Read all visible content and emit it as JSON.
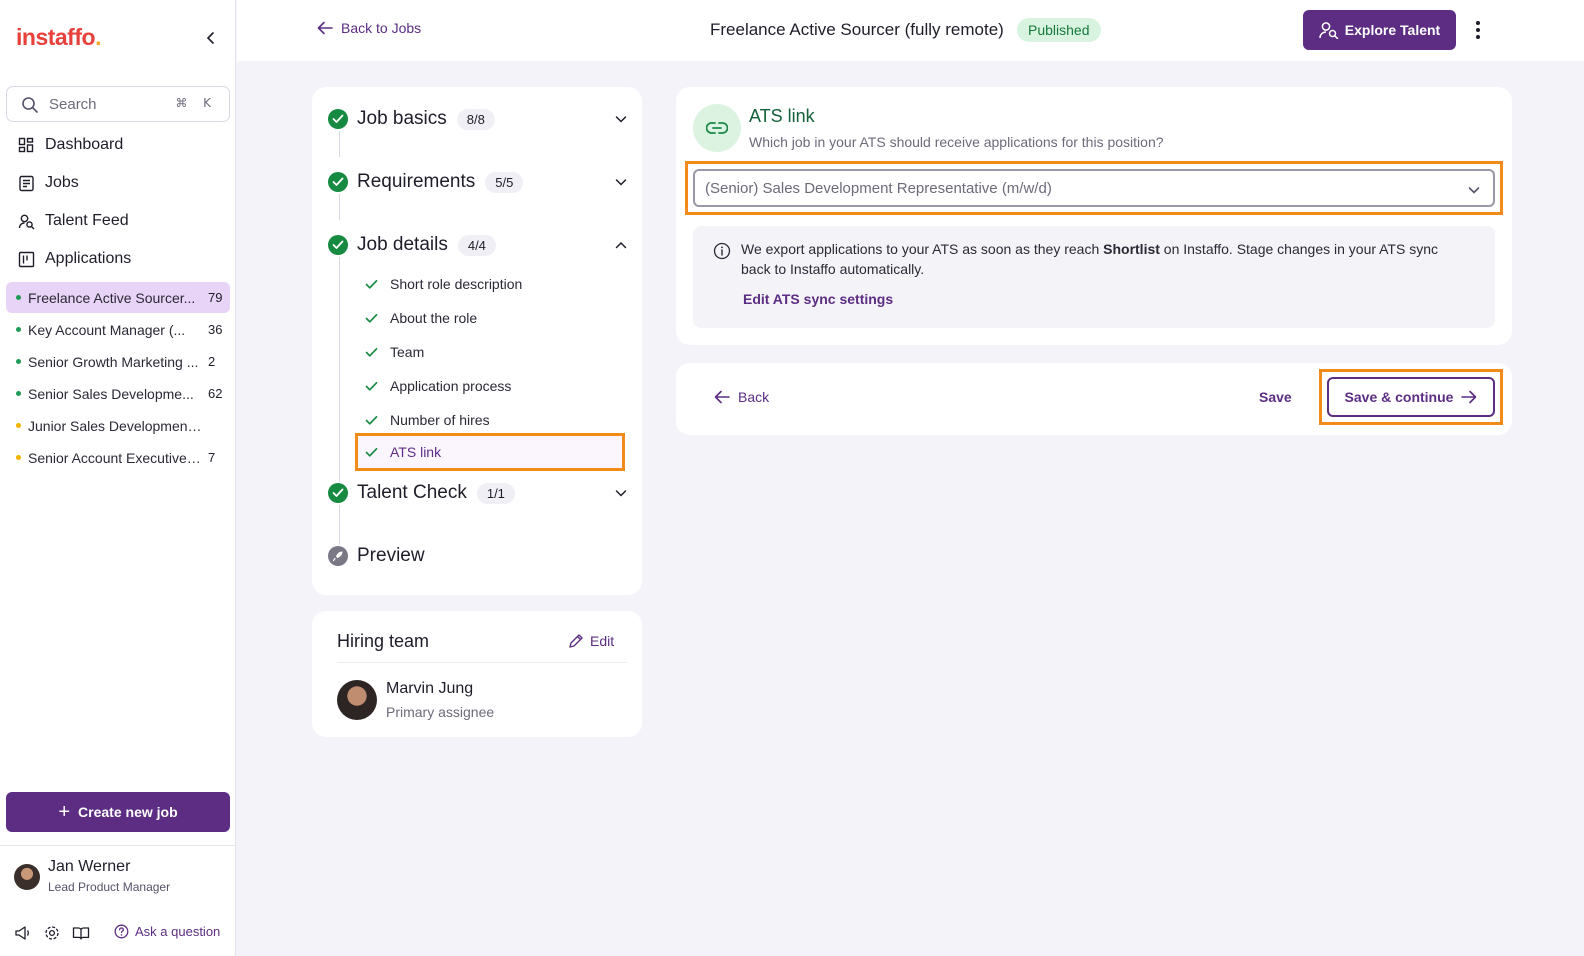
{
  "brand": {
    "logo_text": "instaffo",
    "logo_dot": "."
  },
  "sidebar": {
    "search": {
      "label": "Search",
      "shortcut": "⌘ K"
    },
    "nav": [
      {
        "label": "Dashboard",
        "icon": "dashboard-icon"
      },
      {
        "label": "Jobs",
        "icon": "jobs-icon"
      },
      {
        "label": "Talent Feed",
        "icon": "talent-feed-icon"
      },
      {
        "label": "Applications",
        "icon": "applications-icon"
      }
    ],
    "jobs": [
      {
        "title": "Freelance Active Sourcer...",
        "count": "79",
        "status_color": "#1f9d55",
        "active": true
      },
      {
        "title": "Key Account Manager (...",
        "count": "36",
        "status_color": "#1f9d55"
      },
      {
        "title": "Senior Growth Marketing ...",
        "count": "2",
        "status_color": "#1f9d55"
      },
      {
        "title": "Senior Sales Developme...",
        "count": "62",
        "status_color": "#1f9d55"
      },
      {
        "title": "Junior Sales Development R...",
        "count": "",
        "status_color": "#f5b400"
      },
      {
        "title": "Senior Account Executive ...",
        "count": "7",
        "status_color": "#f5b400"
      }
    ],
    "create_label": "Create new job",
    "user": {
      "name": "Jan Werner",
      "role": "Lead Product Manager"
    },
    "ask_label": "Ask a question"
  },
  "topbar": {
    "back_label": "Back to Jobs",
    "job_title": "Freelance Active Sourcer (fully remote)",
    "status": "Published",
    "explore_label": "Explore Talent"
  },
  "steps": {
    "items": [
      {
        "label": "Job basics",
        "count": "8/8"
      },
      {
        "label": "Requirements",
        "count": "5/5"
      },
      {
        "label": "Job details",
        "count": "4/4"
      },
      {
        "label": "Talent Check",
        "count": "1/1"
      },
      {
        "label": "Preview"
      }
    ],
    "job_details_sub": [
      "Short role description",
      "About the role",
      "Team",
      "Application process",
      "Number of hires",
      "ATS link"
    ]
  },
  "hiring_team": {
    "title": "Hiring team",
    "edit_label": "Edit",
    "assignee_name": "Marvin Jung",
    "assignee_role": "Primary assignee"
  },
  "ats": {
    "title": "ATS link",
    "subtitle": "Which job in your ATS should receive applications for this position?",
    "selected": "(Senior) Sales Development Representative (m/w/d)",
    "info_part1": "We export applications to your ATS as soon as they reach ",
    "info_bold": "Shortlist",
    "info_part2": " on Instaffo. Stage changes in your ATS sync back to Instaffo automatically.",
    "info_link": "Edit ATS sync settings"
  },
  "actions": {
    "back_label": "Back",
    "save_label": "Save",
    "continue_label": "Save & continue"
  },
  "colors": {
    "brand_purple": "#5c2d82",
    "success_green": "#178a41",
    "highlight_orange": "#f28b1a",
    "logo_red": "#e8413b"
  }
}
